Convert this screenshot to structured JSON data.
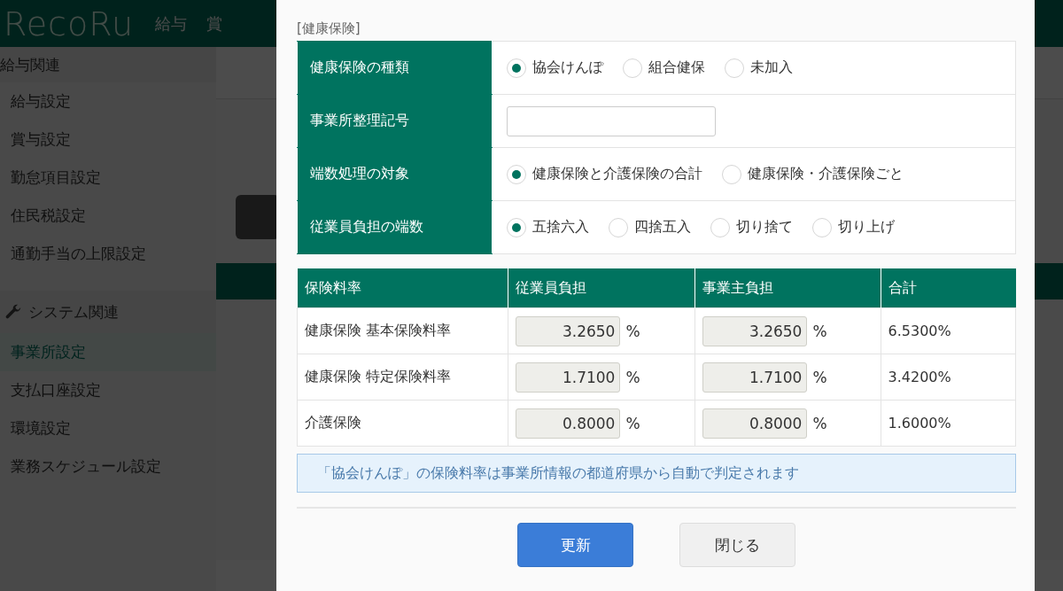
{
  "header": {
    "logo": "RecoRu",
    "nav": [
      {
        "label": "給与"
      },
      {
        "label": "賞"
      }
    ]
  },
  "sidebar": {
    "sections": [
      {
        "title": "給与関連",
        "kind": "plain",
        "items": [
          {
            "label": "給与設定",
            "selected": false
          },
          {
            "label": "賞与設定",
            "selected": false
          },
          {
            "label": "勤怠項目設定",
            "selected": false
          },
          {
            "label": "住民税設定",
            "selected": false
          },
          {
            "label": "通勤手当の上限設定",
            "selected": false
          }
        ]
      },
      {
        "title": "システム関連",
        "kind": "tool",
        "items": [
          {
            "label": "事業所設定",
            "selected": true
          },
          {
            "label": "支払口座設定",
            "selected": false
          },
          {
            "label": "環境設定",
            "selected": false
          },
          {
            "label": "業務スケジュール設定",
            "selected": false
          }
        ]
      }
    ]
  },
  "dialog": {
    "section_title": "[健康保険]",
    "settings": [
      {
        "label": "健康保険の種類",
        "kind": "radio",
        "options": [
          {
            "label": "協会けんぽ",
            "selected": true
          },
          {
            "label": "組合健保",
            "selected": false
          },
          {
            "label": "未加入",
            "selected": false
          }
        ]
      },
      {
        "label": "事業所整理記号",
        "kind": "text"
      },
      {
        "label": "端数処理の対象",
        "kind": "radio",
        "options": [
          {
            "label": "健康保険と介護保険の合計",
            "selected": true
          },
          {
            "label": "健康保険・介護保険ごと",
            "selected": false
          }
        ]
      },
      {
        "label": "従業員負担の端数",
        "kind": "radio",
        "options": [
          {
            "label": "五捨六入",
            "selected": true
          },
          {
            "label": "四捨五入",
            "selected": false
          },
          {
            "label": "切り捨て",
            "selected": false
          },
          {
            "label": "切り上げ",
            "selected": false
          }
        ]
      }
    ],
    "rates": {
      "columns": [
        "保険料率",
        "従業員負担",
        "事業主負担",
        "合計"
      ],
      "rows": [
        {
          "name": "健康保険 基本保険料率",
          "employee": "3.2650",
          "employee_unit": "%",
          "employer": "3.2650",
          "employer_unit": "%",
          "total": "6.5300%",
          "disabled": true
        },
        {
          "name": "健康保険 特定保険料率",
          "employee": "1.7100",
          "employee_unit": "%",
          "employer": "1.7100",
          "employer_unit": "%",
          "total": "3.4200%",
          "disabled": true
        },
        {
          "name": "介護保険",
          "employee": "0.8000",
          "employee_unit": "%",
          "employer": "0.8000",
          "employer_unit": "%",
          "total": "1.6000%",
          "disabled": true
        }
      ]
    },
    "notice": "「協会けんぽ」の保険料率は事業所情報の都道府県から自動で判定されます",
    "buttons": [
      {
        "label": "更新",
        "kind": "primary"
      },
      {
        "label": "閉じる",
        "kind": "secondary"
      }
    ]
  }
}
